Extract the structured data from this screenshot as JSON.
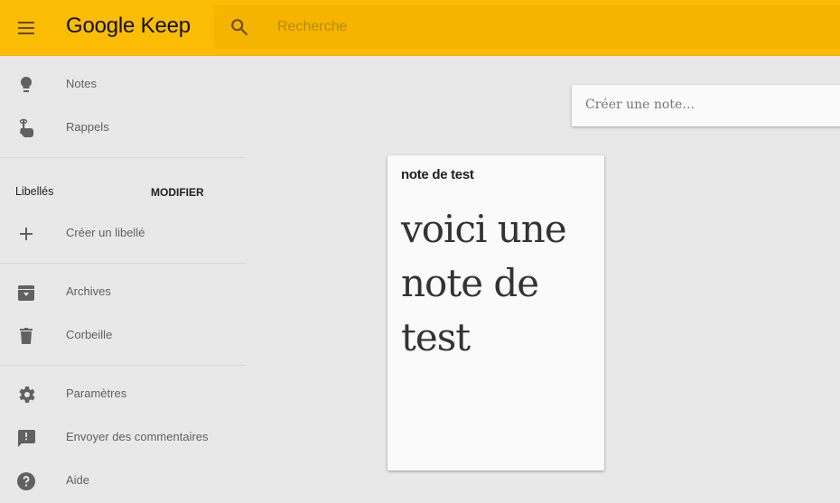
{
  "header": {
    "app_title": "Google Keep",
    "search_placeholder": "Recherche",
    "search_value": "",
    "brand_color": "#fbbc05"
  },
  "sidebar": {
    "items_top": [
      {
        "label": "Notes",
        "icon": "lightbulb-icon"
      },
      {
        "label": "Rappels",
        "icon": "reminder-finger-icon"
      }
    ],
    "labels_section": {
      "heading": "Libellés",
      "modify_label": "MODIFIER",
      "create_label": "Créer un libellé",
      "create_icon": "plus-icon"
    },
    "items_middle": [
      {
        "label": "Archives",
        "icon": "archive-icon"
      },
      {
        "label": "Corbeille",
        "icon": "trash-icon"
      }
    ],
    "items_bottom": [
      {
        "label": "Paramètres",
        "icon": "gear-icon"
      },
      {
        "label": "Envoyer des commentaires",
        "icon": "feedback-icon"
      },
      {
        "label": "Aide",
        "icon": "help-icon"
      }
    ]
  },
  "main": {
    "create_note_placeholder": "Créer une note…",
    "notes": [
      {
        "title": "note de test",
        "body": "voici une note de test"
      }
    ]
  }
}
